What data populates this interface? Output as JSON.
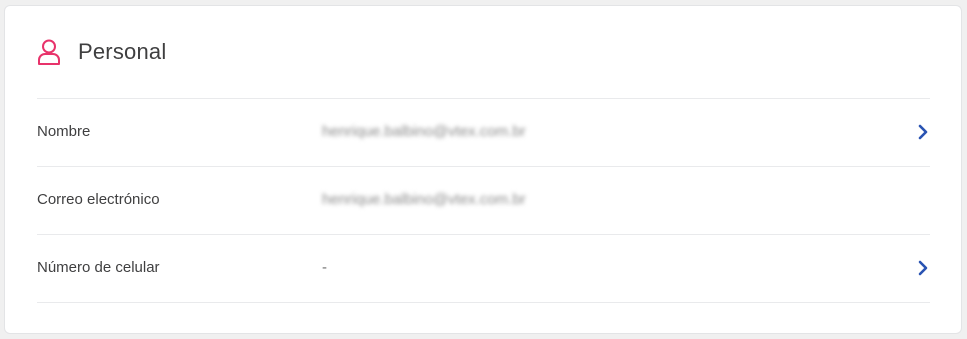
{
  "section": {
    "title": "Personal",
    "icon": "user-icon",
    "icon_color": "#e8336b"
  },
  "rows": [
    {
      "label": "Nombre",
      "value": "henrique.balbino@vtex.com.br",
      "blurred": true,
      "has_chevron": true
    },
    {
      "label": "Correo electrónico",
      "value": "henrique.balbino@vtex.com.br",
      "blurred": true,
      "has_chevron": false
    },
    {
      "label": "Número de celular",
      "value": "-",
      "blurred": false,
      "has_chevron": true
    }
  ],
  "colors": {
    "chevron": "#2953b2",
    "text": "#3f3f40",
    "divider": "#e9eaec"
  }
}
